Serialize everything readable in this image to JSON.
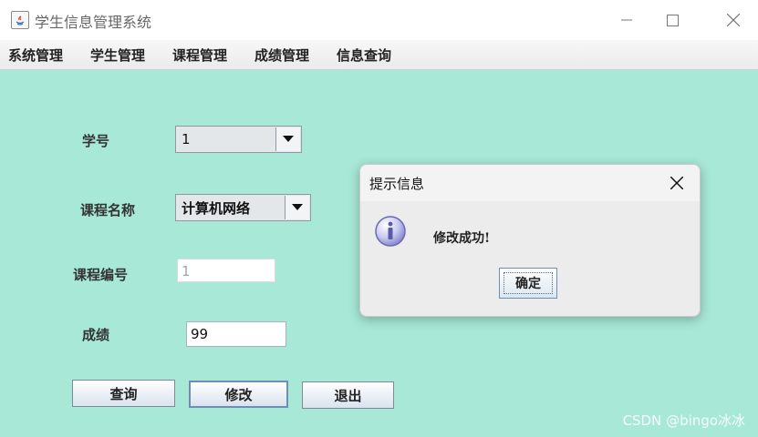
{
  "window": {
    "title": "学生信息管理系统",
    "icon": "java-icon"
  },
  "menu": [
    "系统管理",
    "学生管理",
    "课程管理",
    "成绩管理",
    "信息查询"
  ],
  "form": {
    "student_id_label": "学号",
    "student_id_value": "1",
    "course_name_label": "课程名称",
    "course_name_value": "计算机网络",
    "course_no_label": "课程编号",
    "course_no_value": "1",
    "score_label": "成绩",
    "score_value": "99"
  },
  "buttons": {
    "query": "查询",
    "modify": "修改",
    "exit": "退出"
  },
  "dialog": {
    "title": "提示信息",
    "message": "修改成功!",
    "ok": "确定",
    "icon": "info-icon"
  },
  "watermark": "CSDN @bingo冰冰"
}
